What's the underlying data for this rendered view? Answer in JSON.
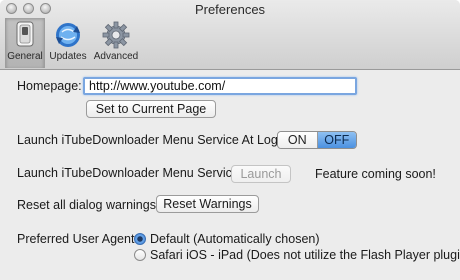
{
  "window": {
    "title": "Preferences"
  },
  "toolbar": {
    "general": "General",
    "updates": "Updates",
    "advanced": "Advanced"
  },
  "homepage": {
    "label": "Homepage:",
    "value": "http://www.youtube.com/",
    "set_current_button": "Set to Current Page"
  },
  "launch_at_login": {
    "label": "Launch iTubeDownloader Menu Service At Login:",
    "on": "ON",
    "off": "OFF",
    "selected": "OFF"
  },
  "launch_service": {
    "label": "Launch iTubeDownloader Menu Service:",
    "button": "Launch",
    "note": "Feature coming soon!"
  },
  "reset": {
    "label": "Reset all dialog warnings:",
    "button": "Reset Warnings"
  },
  "user_agent": {
    "label": "Preferred User Agent:",
    "options": [
      {
        "label": "Default (Automatically chosen)",
        "checked": true
      },
      {
        "label": "Safari iOS - iPad (Does not utilize the Flash Player plugi",
        "checked": false
      }
    ]
  },
  "colors": {
    "accent": "#4b90e0",
    "focus_ring": "#7aa6e0"
  }
}
